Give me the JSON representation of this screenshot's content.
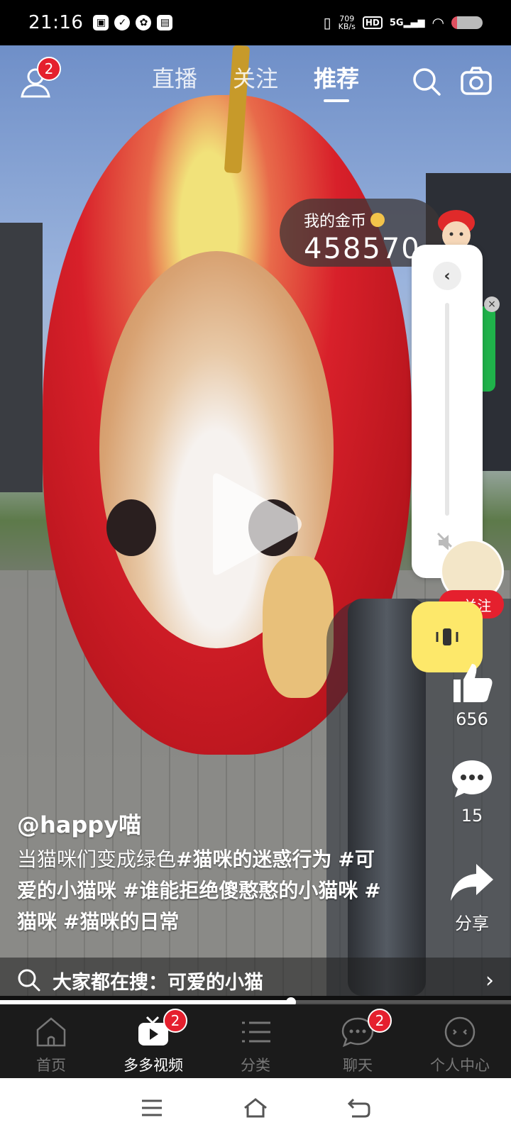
{
  "status_bar": {
    "time": "21:16",
    "netspeed_value": "709",
    "netspeed_unit": "KB/s",
    "hd_label": "HD",
    "signal_label": "5G"
  },
  "top_nav": {
    "user_badge": "2",
    "tabs": [
      {
        "label": "直播",
        "active": false
      },
      {
        "label": "关注",
        "active": false
      },
      {
        "label": "推荐",
        "active": true
      }
    ]
  },
  "coins": {
    "label": "我的金币",
    "value": "458570"
  },
  "side_actions": {
    "follow_label": "+关注",
    "like_count": "656",
    "comment_count": "15",
    "share_label": "分享"
  },
  "video_info": {
    "author": "@happy喵",
    "desc_plain": "当猫咪们变成绿色",
    "tags": [
      "#猫咪的迷惑行为",
      "#可爱的小猫咪",
      "#谁能拒绝傻憨憨的小猫咪",
      "#猫咪",
      "#猫咪的日常"
    ]
  },
  "search_suggest": {
    "text": "大家都在搜：可爱的小猫"
  },
  "progress": {
    "fraction": 0.57
  },
  "bottom_nav": [
    {
      "label": "首页",
      "active": false,
      "badge": ""
    },
    {
      "label": "多多视频",
      "active": true,
      "badge": "2"
    },
    {
      "label": "分类",
      "active": false,
      "badge": ""
    },
    {
      "label": "聊天",
      "active": false,
      "badge": "2"
    },
    {
      "label": "个人中心",
      "active": false,
      "badge": ""
    }
  ]
}
